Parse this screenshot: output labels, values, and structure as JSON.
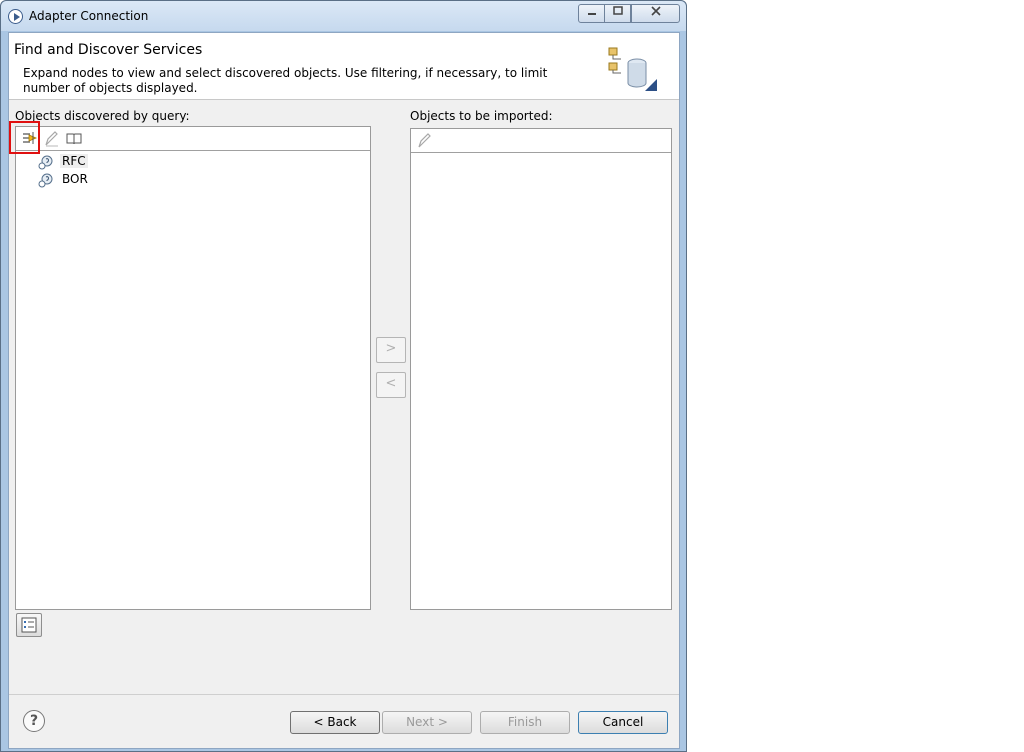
{
  "window": {
    "title": "Adapter Connection"
  },
  "header": {
    "title": "Find and Discover Services",
    "description": "Expand nodes to view and select discovered objects. Use filtering, if necessary, to limit number of objects displayed."
  },
  "left_panel": {
    "label": "Objects discovered by query:",
    "items": [
      {
        "label": "RFC",
        "icon": "query-node-icon"
      },
      {
        "label": "BOR",
        "icon": "query-node-icon"
      }
    ]
  },
  "right_panel": {
    "label": "Objects to be imported:"
  },
  "move_buttons": {
    "add": ">",
    "remove": "<"
  },
  "footer": {
    "help": "?",
    "back": "< Back",
    "next": "Next >",
    "finish": "Finish",
    "cancel": "Cancel"
  },
  "colors": {
    "titlebar": "#c6d9ee",
    "client_bg": "#f0f0f0",
    "highlight": "#e01010"
  }
}
